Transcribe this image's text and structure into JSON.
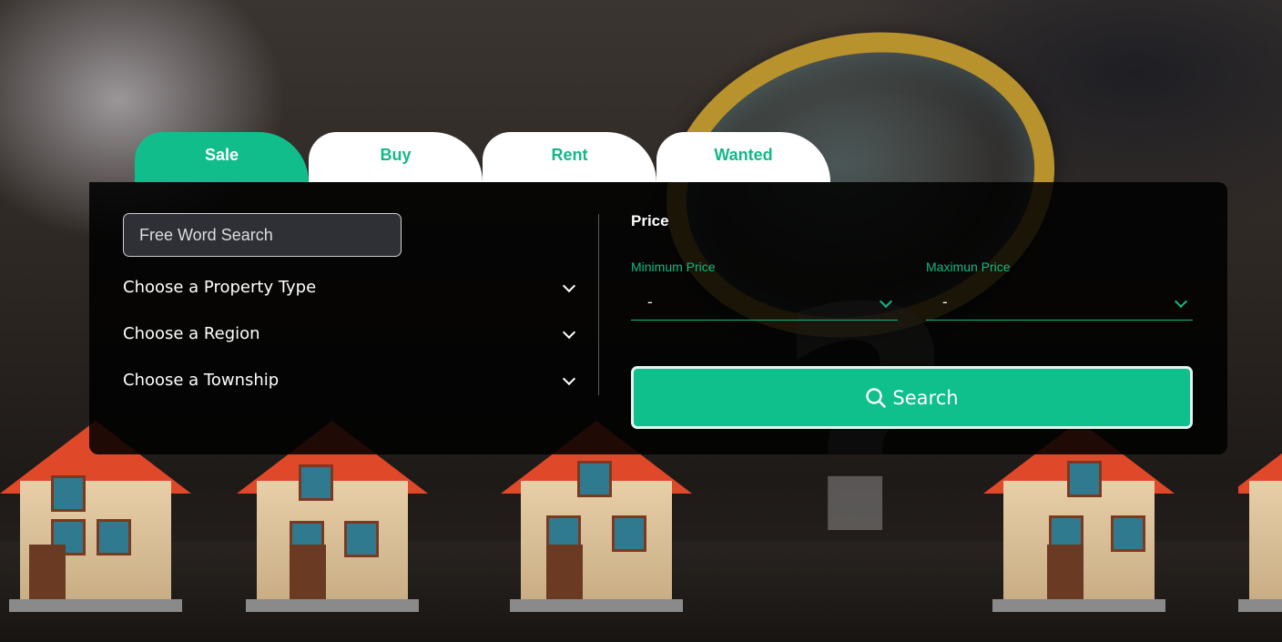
{
  "tabs": [
    {
      "label": "Sale",
      "active": true
    },
    {
      "label": "Buy",
      "active": false
    },
    {
      "label": "Rent",
      "active": false
    },
    {
      "label": "Wanted",
      "active": false
    }
  ],
  "search_form": {
    "free_word_placeholder": "Free Word Search",
    "property_type": "Choose a Property Type",
    "region": "Choose a Region",
    "township": "Choose a Township"
  },
  "price": {
    "title": "Price",
    "min_label": "Minimum Price",
    "min_value": "-",
    "max_label": "Maximun Price",
    "max_value": "-"
  },
  "search_button": {
    "label": "Search",
    "icon": "search-icon"
  },
  "colors": {
    "accent": "#12b886",
    "panel": "#000000",
    "tab_inactive": "#ffffff"
  }
}
